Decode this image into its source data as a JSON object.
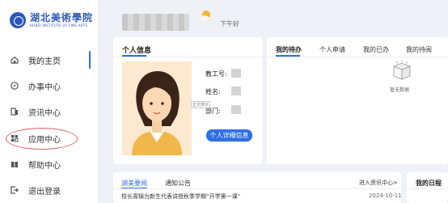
{
  "sidebar": {
    "logo_cn": "湖北美術學院",
    "logo_en": "HUBEI INSTITUTE OF FINE ARTS",
    "items": [
      {
        "label": "我的主页",
        "icon": "home-icon",
        "active": true
      },
      {
        "label": "办事中心",
        "icon": "compass-icon"
      },
      {
        "label": "资讯中心",
        "icon": "news-icon"
      },
      {
        "label": "应用中心",
        "icon": "grid-icon",
        "highlighted": true
      },
      {
        "label": "帮助中心",
        "icon": "book-icon"
      },
      {
        "label": "退出登录",
        "icon": "logout-icon"
      }
    ]
  },
  "header": {
    "greeting": "下午好",
    "weather_icon": "sun-cloud-icon"
  },
  "profile": {
    "title": "个人信息",
    "fields": [
      {
        "label": "教工号:"
      },
      {
        "label": "姓名:"
      },
      {
        "label": "部门:"
      }
    ],
    "watermark": "正文部分",
    "detail_button": "个人详细信息"
  },
  "todo": {
    "tabs": [
      "我的待办",
      "个人申请",
      "我的已办",
      "我的待阅"
    ],
    "empty_text": "暂无数据"
  },
  "news": {
    "tabs": [
      "湖美要闻",
      "通知公告"
    ],
    "more": "进入资讯中心>",
    "items": [
      {
        "title": "校长周锦为新生代表讲授秋季学期“开学第一课”",
        "date": "2024-10-11"
      }
    ]
  },
  "schedule": {
    "title": "我的日程"
  },
  "colors": {
    "primary": "#2f6fe4",
    "brand": "#2b57b8",
    "highlight": "#e06060"
  }
}
